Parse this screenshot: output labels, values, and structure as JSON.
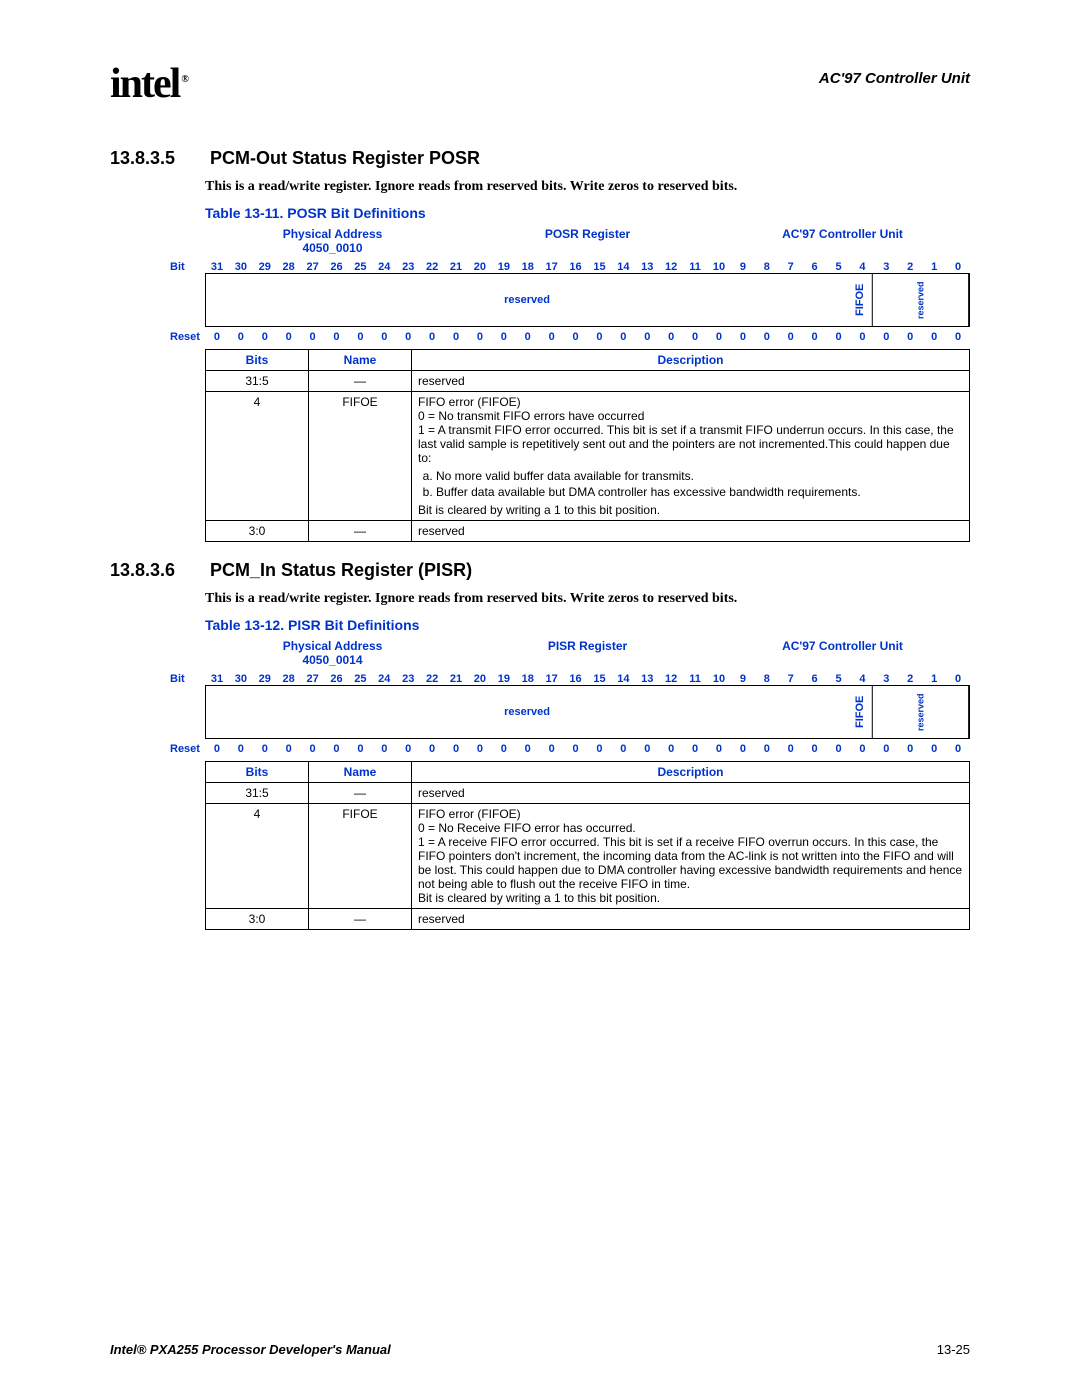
{
  "header": {
    "logo_text": "intel",
    "logo_mark": "®",
    "chapter": "AC'97 Controller Unit"
  },
  "section1": {
    "number": "13.8.3.5",
    "title": "PCM-Out Status Register POSR",
    "body": "This is a read/write register. Ignore reads from reserved bits. Write zeros to reserved bits.",
    "table_caption": "Table 13-11. POSR Bit Definitions",
    "phys_addr_label": "Physical Address",
    "phys_addr_value": "4050_0010",
    "reg_name": "POSR Register",
    "unit": "AC'97 Controller Unit",
    "bit_label": "Bit",
    "reset_label": "Reset",
    "layout_reserved": "reserved",
    "layout_fifoe": "FIFOE",
    "layout_reserved2": "reserved",
    "bits": [
      "31",
      "30",
      "29",
      "28",
      "27",
      "26",
      "25",
      "24",
      "23",
      "22",
      "21",
      "20",
      "19",
      "18",
      "17",
      "16",
      "15",
      "14",
      "13",
      "12",
      "11",
      "10",
      "9",
      "8",
      "7",
      "6",
      "5",
      "4",
      "3",
      "2",
      "1",
      "0"
    ],
    "resets": [
      "0",
      "0",
      "0",
      "0",
      "0",
      "0",
      "0",
      "0",
      "0",
      "0",
      "0",
      "0",
      "0",
      "0",
      "0",
      "0",
      "0",
      "0",
      "0",
      "0",
      "0",
      "0",
      "0",
      "0",
      "0",
      "0",
      "0",
      "0",
      "0",
      "0",
      "0",
      "0"
    ],
    "def_headers": {
      "bits": "Bits",
      "name": "Name",
      "desc": "Description"
    },
    "defs": {
      "r0": {
        "bits": "31:5",
        "name": "—",
        "desc": "reserved"
      },
      "r1": {
        "bits": "4",
        "name": "FIFOE",
        "title": "FIFO error (FIFOE)",
        "l0": "0 =  No transmit FIFO errors have occurred",
        "l1": "1 =  A transmit FIFO error occurred. This bit is set if a transmit FIFO underrun occurs. In this case, the last valid sample is repetitively sent out and the pointers are not incremented.This could happen due to:",
        "a": "No more valid buffer data available for transmits.",
        "b": "Buffer data available but DMA controller has excessive bandwidth requirements.",
        "clear": "Bit is cleared by writing a 1 to this bit position."
      },
      "r2": {
        "bits": "3:0",
        "name": "—",
        "desc": "reserved"
      }
    }
  },
  "section2": {
    "number": "13.8.3.6",
    "title": "PCM_In Status Register (PISR)",
    "body": "This is a read/write register. Ignore reads from reserved bits. Write zeros to reserved bits.",
    "table_caption": "Table 13-12. PISR Bit Definitions",
    "phys_addr_label": "Physical Address",
    "phys_addr_value": "4050_0014",
    "reg_name": "PISR Register",
    "unit": "AC'97 Controller Unit",
    "bit_label": "Bit",
    "reset_label": "Reset",
    "layout_reserved": "reserved",
    "layout_fifoe": "FIFOE",
    "layout_reserved2": "reserved",
    "bits": [
      "31",
      "30",
      "29",
      "28",
      "27",
      "26",
      "25",
      "24",
      "23",
      "22",
      "21",
      "20",
      "19",
      "18",
      "17",
      "16",
      "15",
      "14",
      "13",
      "12",
      "11",
      "10",
      "9",
      "8",
      "7",
      "6",
      "5",
      "4",
      "3",
      "2",
      "1",
      "0"
    ],
    "resets": [
      "0",
      "0",
      "0",
      "0",
      "0",
      "0",
      "0",
      "0",
      "0",
      "0",
      "0",
      "0",
      "0",
      "0",
      "0",
      "0",
      "0",
      "0",
      "0",
      "0",
      "0",
      "0",
      "0",
      "0",
      "0",
      "0",
      "0",
      "0",
      "0",
      "0",
      "0",
      "0"
    ],
    "def_headers": {
      "bits": "Bits",
      "name": "Name",
      "desc": "Description"
    },
    "defs": {
      "r0": {
        "bits": "31:5",
        "name": "—",
        "desc": "reserved"
      },
      "r1": {
        "bits": "4",
        "name": "FIFOE",
        "title": "FIFO error (FIFOE)",
        "l0": "0 =  No Receive FIFO error has occurred.",
        "l1": "1 =  A receive FIFO error occurred. This bit is set if a receive FIFO overrun occurs. In this case, the FIFO pointers don't increment, the incoming data from the AC-link is not written into the FIFO and will be lost. This could happen due to DMA controller having excessive bandwidth requirements and hence not being able to flush out the receive FIFO in time.",
        "clear": "Bit is cleared by writing a 1 to this bit position."
      },
      "r2": {
        "bits": "3:0",
        "name": "—",
        "desc": "reserved"
      }
    }
  },
  "footer": {
    "left": "Intel® PXA255 Processor Developer's Manual",
    "right": "13-25"
  }
}
